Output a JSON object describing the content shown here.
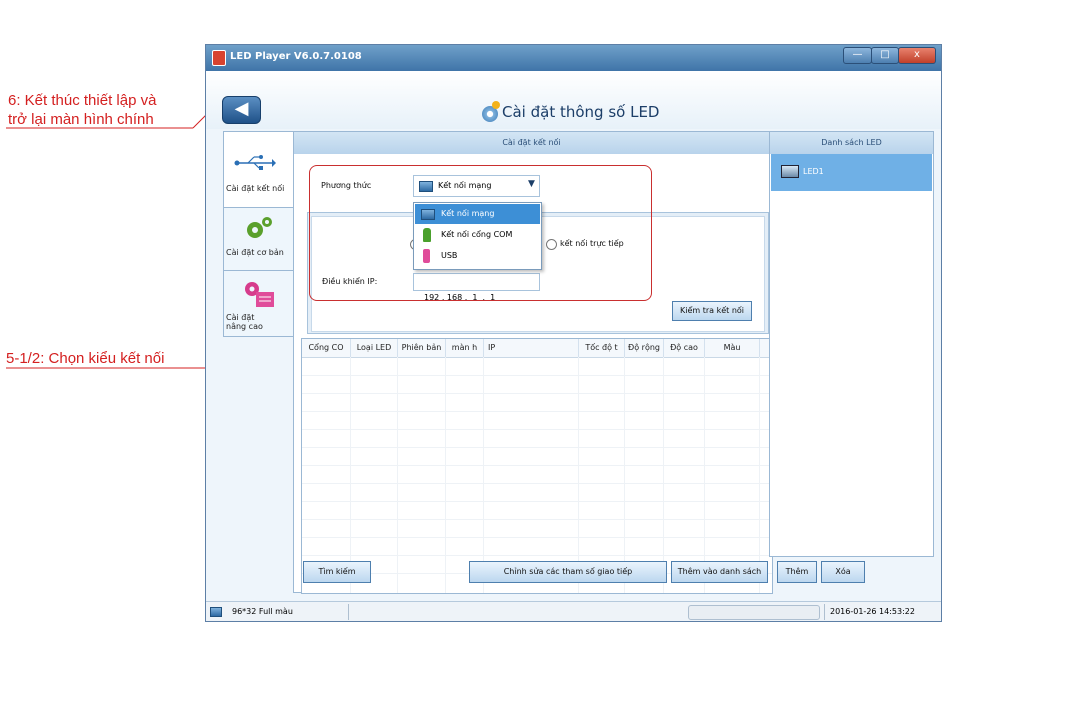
{
  "annotations": {
    "note6_line1": "6: Kết thúc thiết lập và",
    "note6_line2": "trở lại màn hình chính",
    "note5": "5-1/2: Chọn kiểu kết nối"
  },
  "window": {
    "title": "LED Player V6.0.7.0108",
    "min_glyph": "—",
    "max_glyph": "□",
    "close_glyph": "x"
  },
  "header": {
    "back_glyph": "◀",
    "page_title": "Cài đặt thông số LED"
  },
  "nav": {
    "items": [
      {
        "label": "Cài đặt kết nối",
        "icon": "usb-icon"
      },
      {
        "label": "Cài đặt cơ bản",
        "icon": "gears-icon"
      },
      {
        "label": "Cài đặt nâng cao",
        "icon": "advanced-settings-icon"
      }
    ]
  },
  "connection": {
    "panel_title": "Cài đặt kết nối",
    "method_label": "Phương thức",
    "method_value": "Kết nối mạng",
    "method_options": [
      "Kết nối mạng",
      "Kết nối cổng COM",
      "USB"
    ],
    "radio_direct_label": "kết nối trực tiếp",
    "ip_label": "Điều khiển IP:",
    "ip_value": "192 . 168 .  1  .  1",
    "check_button": "Kiểm tra kết nối"
  },
  "table": {
    "columns": [
      "Cổng CO",
      "Loại LED",
      "Phiên bản",
      "màn h",
      "IP",
      "Tốc độ t",
      "Độ rộng",
      "Độ cao",
      "Màu"
    ]
  },
  "buttons": {
    "search": "Tìm kiếm",
    "edit_params": "Chỉnh sửa các tham số giao tiếp",
    "add_to_list": "Thêm vào danh sách",
    "add": "Thêm",
    "delete": "Xóa"
  },
  "led_list": {
    "title": "Danh sách LED",
    "items": [
      "LED1"
    ]
  },
  "status": {
    "screen_info": "96*32 Full màu",
    "datetime": "2016-01-26 14:53:22"
  },
  "colors": {
    "annotation_red": "#d42020",
    "title_bar_blue": "#3f74a8",
    "selection_blue": "#3d8fd6"
  }
}
